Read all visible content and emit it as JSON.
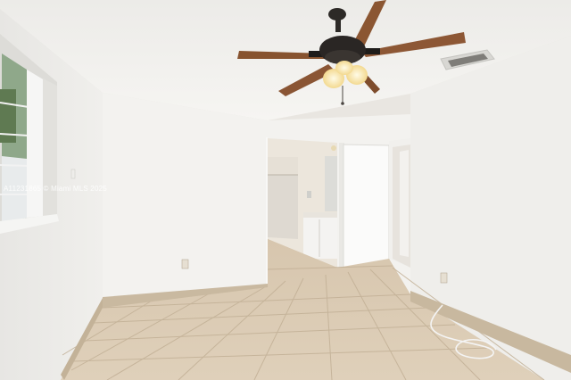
{
  "photo": {
    "subject": "empty bedroom interior",
    "watermark": "A11231865 © Miami MLS 2025"
  },
  "colors": {
    "ceiling": "#f1efeb",
    "left_wall": "#ecebe7",
    "back_wall": "#f4f3f0",
    "right_wall": "#eeedea",
    "floor_tile": "#d9c7ae",
    "grout": "#bfae96",
    "baseboard": "#c8b89e",
    "fan_blade": "#8a5534",
    "fan_motor": "#2a2624"
  }
}
